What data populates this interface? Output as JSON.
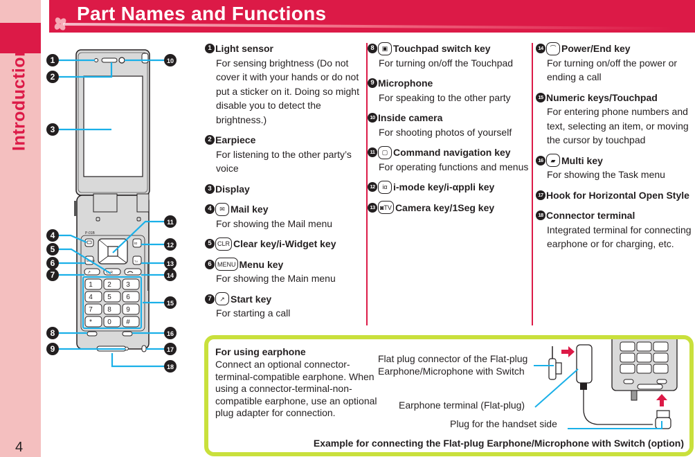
{
  "side_tab": {
    "section": "Introduction",
    "page_number": "4"
  },
  "header": {
    "title": "Part Names and Functions"
  },
  "colors": {
    "brand": "#dc1a47",
    "side_tab_bg": "#f4bfbf",
    "callout_line": "#1ab0e8",
    "box_border": "#c9e03c",
    "phone_body": "#d9d9d9"
  },
  "callouts": [
    "1",
    "2",
    "3",
    "4",
    "5",
    "6",
    "7",
    "8",
    "9",
    "10",
    "11",
    "12",
    "13",
    "14",
    "15",
    "16",
    "17",
    "18"
  ],
  "phone": {
    "model_label": "P-01B"
  },
  "parts": [
    {
      "num": "1",
      "icon": null,
      "name": "Light sensor",
      "desc": "For sensing brightness (Do not cover it with your hands or do not put a sticker on it. Doing so might disable you to detect the brightness.)"
    },
    {
      "num": "2",
      "icon": null,
      "name": "Earpiece",
      "desc": "For listening to the other party’s voice"
    },
    {
      "num": "3",
      "icon": null,
      "name": "Display",
      "desc": ""
    },
    {
      "num": "4",
      "icon": "mail-key-icon",
      "icon_glyph": "✉",
      "name": "Mail key",
      "desc": "For showing the Mail menu"
    },
    {
      "num": "5",
      "icon": "clear-key-icon",
      "icon_glyph": "CLR",
      "name": "Clear key/i-Widget key",
      "desc": ""
    },
    {
      "num": "6",
      "icon": "menu-key-icon",
      "icon_glyph": "MENU",
      "name": "Menu key",
      "desc": "For showing the Main menu"
    },
    {
      "num": "7",
      "icon": "start-key-icon",
      "icon_glyph": "↗",
      "name": "Start key",
      "desc": "For starting a call"
    },
    {
      "num": "8",
      "icon": "touchpad-switch-key-icon",
      "icon_glyph": "▣",
      "name": "Touchpad switch key",
      "desc": "For turning on/off the Touchpad"
    },
    {
      "num": "9",
      "icon": null,
      "name": "Microphone",
      "desc": "For speaking to the other party"
    },
    {
      "num": "10",
      "icon": null,
      "name": "Inside camera",
      "desc": "For shooting photos of yourself"
    },
    {
      "num": "11",
      "icon": "command-navigation-key-icon",
      "icon_glyph": "▢",
      "name": "Command navigation key",
      "desc": "For operating functions and menus"
    },
    {
      "num": "12",
      "icon": "imode-key-icon",
      "icon_glyph": "iα",
      "name": "i-mode key/i-αppli key",
      "desc": ""
    },
    {
      "num": "13",
      "icon": "camera-key-icon",
      "icon_glyph": "◙TV",
      "name": "Camera key/1Seg key",
      "desc": ""
    },
    {
      "num": "14",
      "icon": "power-end-key-icon",
      "icon_glyph": "⌒",
      "name": "Power/End key",
      "desc": "For turning on/off the power or ending a call"
    },
    {
      "num": "15",
      "icon": null,
      "name": "Numeric keys/Touchpad",
      "desc": "For entering phone numbers and text, selecting an item, or moving the cursor by touchpad"
    },
    {
      "num": "16",
      "icon": "multi-key-icon",
      "icon_glyph": "▰",
      "name": "Multi key",
      "desc": "For showing the Task menu"
    },
    {
      "num": "17",
      "icon": null,
      "name": "Hook for Horizontal Open Style",
      "desc": ""
    },
    {
      "num": "18",
      "icon": null,
      "name": "Connector terminal",
      "desc": "Integrated terminal for connecting earphone or for charging, etc."
    }
  ],
  "earphone_box": {
    "title": "For using earphone",
    "body": "Connect an optional connector-terminal-compatible earphone. When using a connector-terminal-non-compatible earphone, use an optional plug adapter for connection.",
    "label_flat_plug": "Flat plug connector of the Flat-plug Earphone/Microphone with Switch",
    "label_terminal": "Earphone terminal (Flat-plug)",
    "label_plug": "Plug for the handset side",
    "caption": "Example for connecting the Flat-plug Earphone/Microphone with Switch (option)"
  }
}
